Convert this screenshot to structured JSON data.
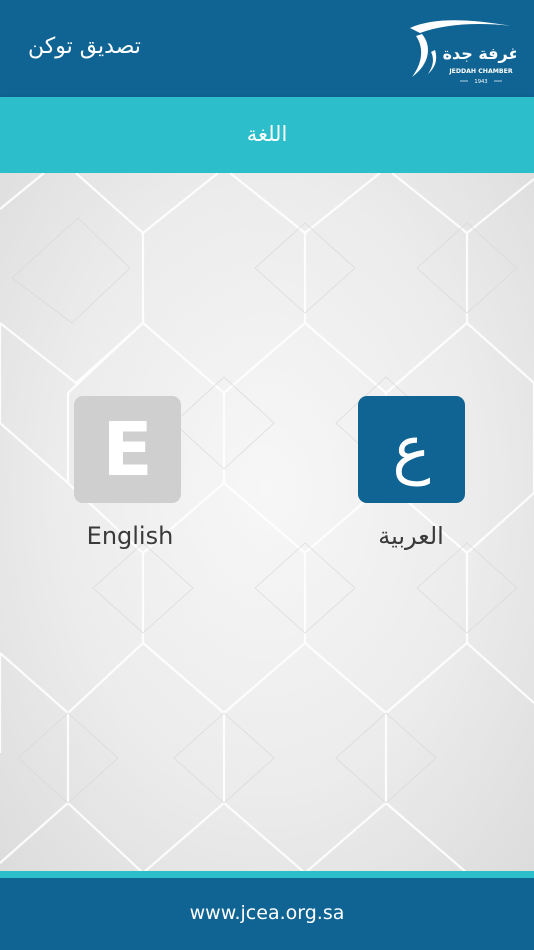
{
  "header": {
    "title": "تصديق توكن",
    "logo": {
      "arabic_name": "غرفة جدة",
      "english_name": "JEDDAH CHAMBER",
      "year": "1943"
    }
  },
  "section": {
    "title": "اللغة"
  },
  "languages": [
    {
      "letter": "E",
      "label": "English"
    },
    {
      "letter": "ع",
      "label": "العربية"
    }
  ],
  "footer": {
    "website": "www.jcea.org.sa"
  },
  "colors": {
    "primary": "#0f6494",
    "accent": "#2cbfcb",
    "inactive_tile": "#cfcfcf"
  }
}
